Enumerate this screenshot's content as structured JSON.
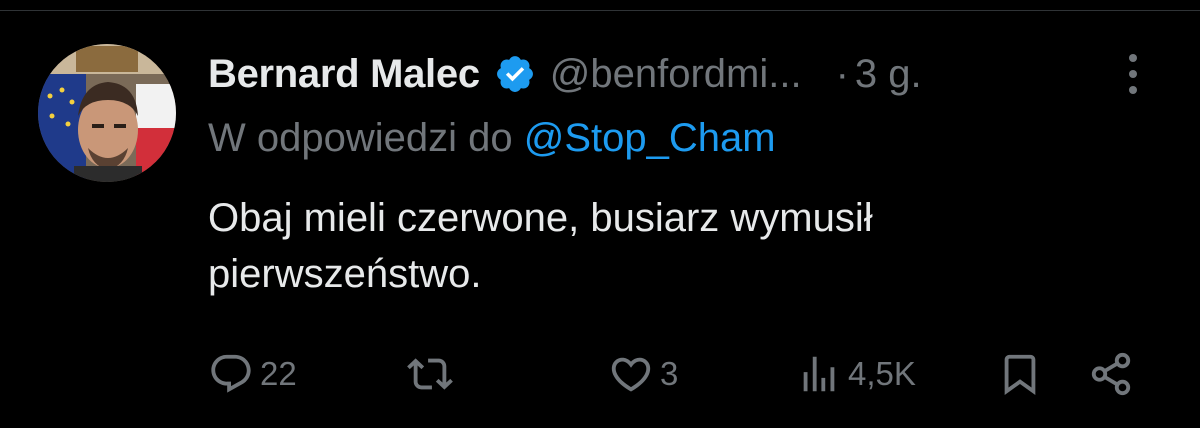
{
  "tweet": {
    "author_name": "Bernard Malec",
    "handle": "@benfordmi...",
    "separator": "·",
    "time": "3 g.",
    "reply_prefix": "W odpowiedzi do",
    "reply_to": "@Stop_Cham",
    "text_line1": "Obaj mieli czerwone, busiarz wymusił",
    "text_line2": "pierwszeństwo.",
    "verified": true
  },
  "actions": {
    "replies": "22",
    "reposts": "",
    "likes": "3",
    "views": "4,5K"
  },
  "colors": {
    "background": "#000000",
    "primary_text": "#e7e9ea",
    "secondary_text": "#71767b",
    "accent": "#1d9bf0"
  },
  "icons": [
    "verified-badge-icon",
    "more-icon",
    "reply-icon",
    "repost-icon",
    "like-icon",
    "views-icon",
    "bookmark-icon",
    "share-icon"
  ]
}
